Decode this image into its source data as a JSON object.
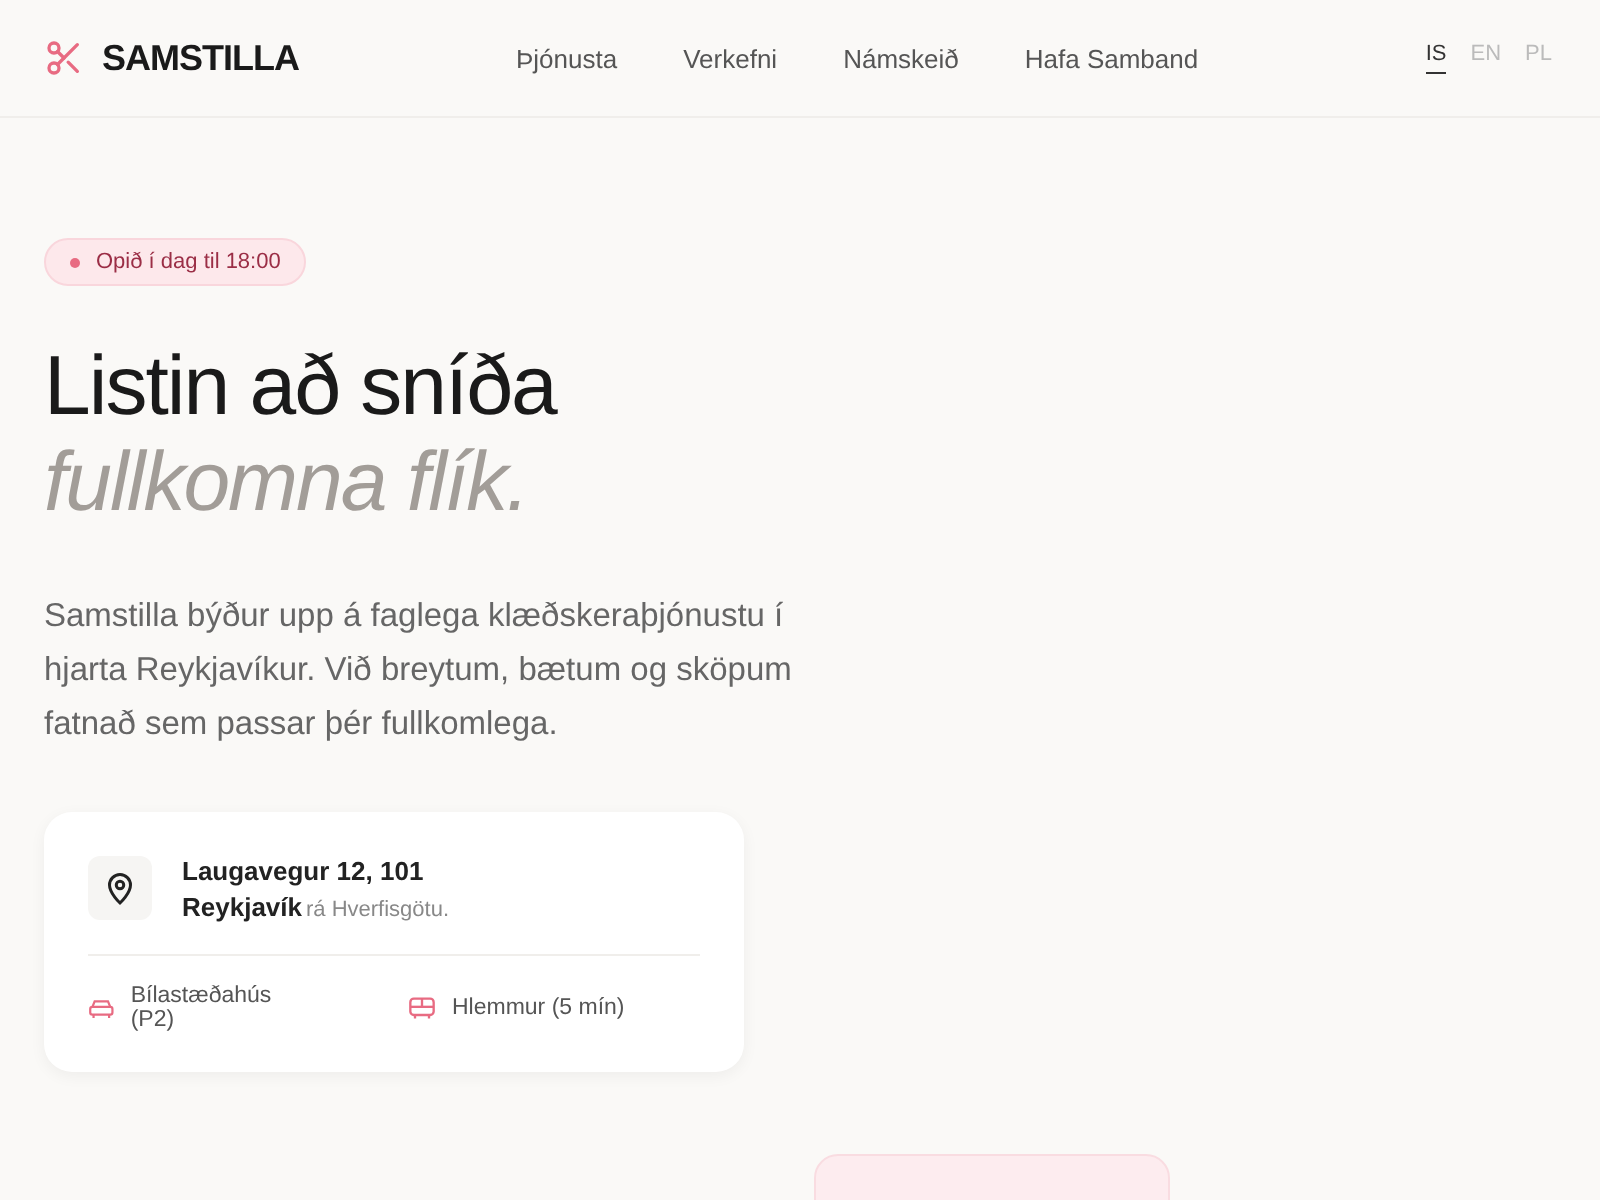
{
  "brand": {
    "name": "SAMSTILLA"
  },
  "nav": [
    {
      "label": "Þjónusta"
    },
    {
      "label": "Verkefni"
    },
    {
      "label": "Námskeið"
    },
    {
      "label": "Hafa Samband"
    }
  ],
  "languages": [
    {
      "label": "IS",
      "selected": true
    },
    {
      "label": "EN",
      "selected": false
    },
    {
      "label": "PL",
      "selected": false
    }
  ],
  "status_badge": {
    "text": "Opið í dag til 18:00"
  },
  "headline": {
    "line_1": "Listin að sníða",
    "line_2": "fullkomna flík."
  },
  "intro": "Samstilla býður upp á faglega klæðskeraþjónustu í hjarta Reykjavíkur. Við breytum, bætum og sköpum fatnað sem passar þér fullkomlega.",
  "location": {
    "address_line_1": "Laugavegur 12, 101",
    "address_line_2": "Reykjavík",
    "note": "rá Hverfisgötu.",
    "amenities": [
      {
        "kind": "car",
        "label": "Bílastæðahús (P2)"
      },
      {
        "kind": "bus",
        "label": "Hlemmur (5 mín)"
      }
    ]
  }
}
